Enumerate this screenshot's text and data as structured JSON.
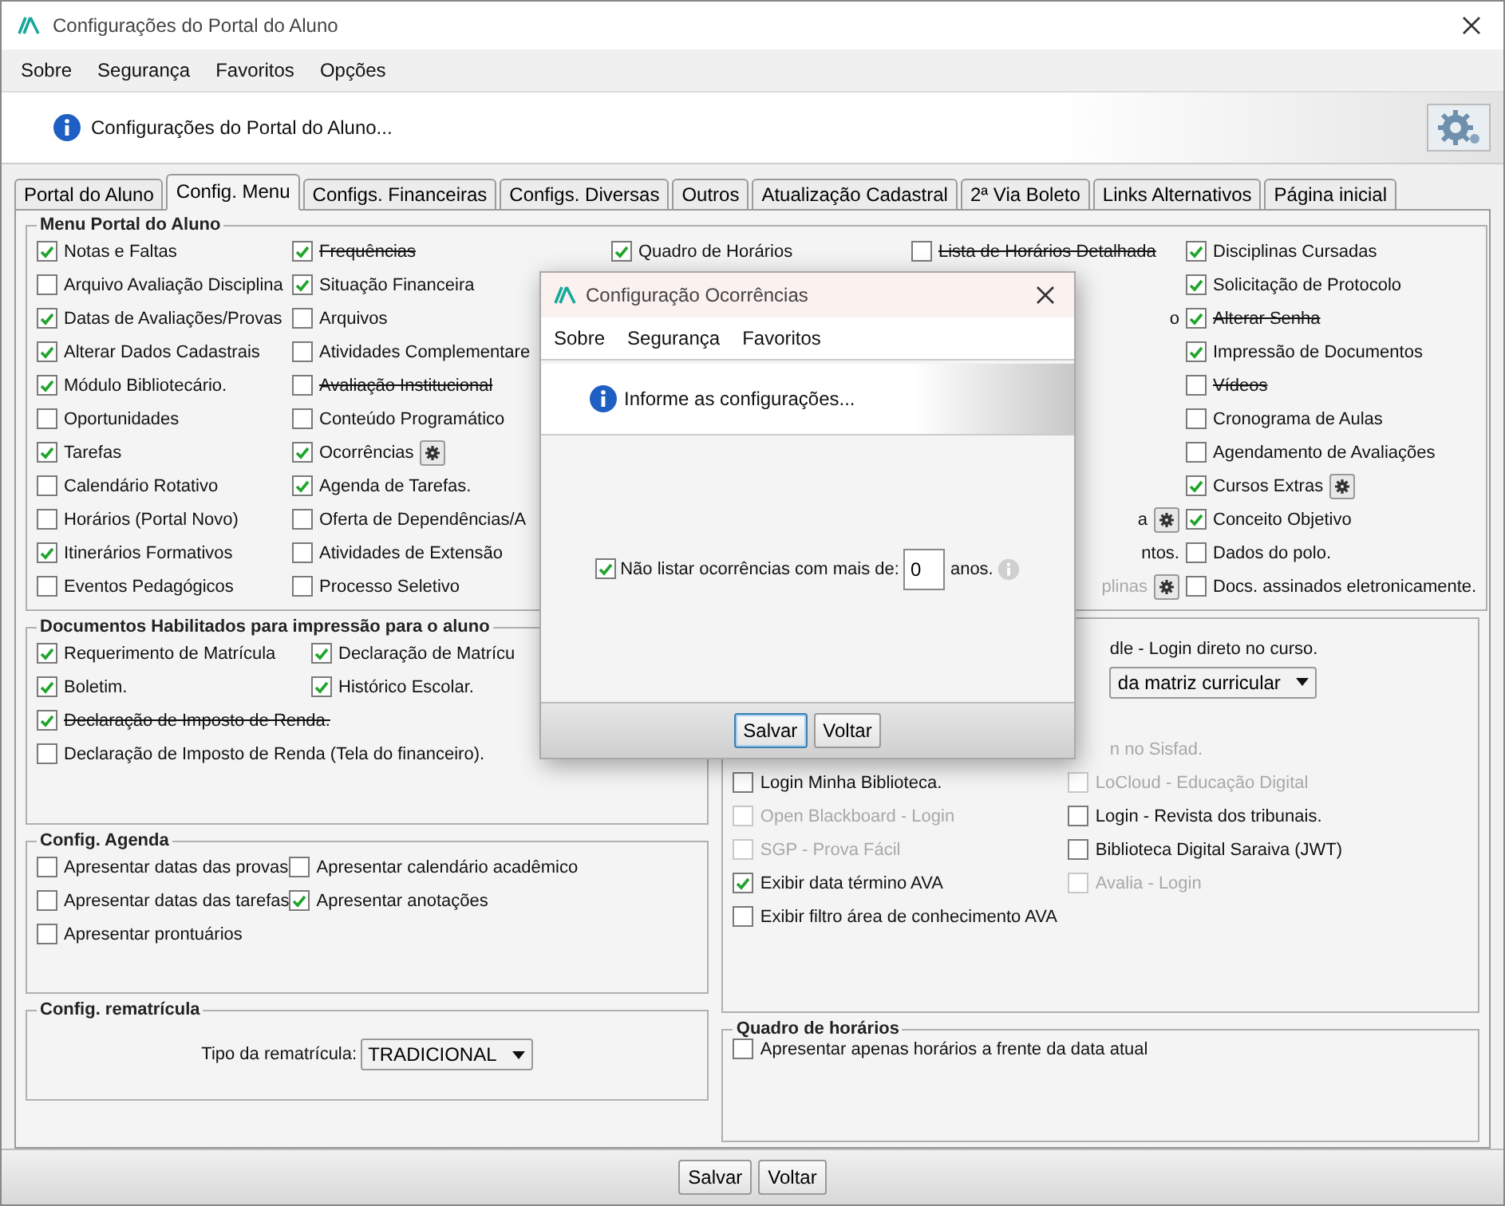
{
  "window": {
    "title": "Configurações do Portal do Aluno"
  },
  "menu_bar": [
    "Sobre",
    "Segurança",
    "Favoritos",
    "Opções"
  ],
  "header": {
    "message": "Configurações do Portal do Aluno..."
  },
  "tabs": [
    {
      "label": "Portal do Aluno",
      "selected": false
    },
    {
      "label": "Config. Menu",
      "selected": true
    },
    {
      "label": "Configs. Financeiras",
      "selected": false
    },
    {
      "label": "Configs. Diversas",
      "selected": false
    },
    {
      "label": "Outros",
      "selected": false
    },
    {
      "label": "Atualização Cadastral",
      "selected": false
    },
    {
      "label": "2ª Via Boleto",
      "selected": false
    },
    {
      "label": "Links Alternativos",
      "selected": false
    },
    {
      "label": "Página inicial",
      "selected": false
    }
  ],
  "menu_group": {
    "title": "Menu Portal do Aluno",
    "columns": [
      [
        {
          "kind": "check",
          "label": "Notas e Faltas",
          "checked": true,
          "struck": false,
          "settings": false
        },
        {
          "kind": "check",
          "label": "Arquivo Avaliação Disciplina",
          "checked": false,
          "struck": false,
          "settings": false
        },
        {
          "kind": "check",
          "label": "Datas de Avaliações/Provas",
          "checked": true,
          "struck": false,
          "settings": false
        },
        {
          "kind": "check",
          "label": "Alterar Dados Cadastrais",
          "checked": true,
          "struck": false,
          "settings": false
        },
        {
          "kind": "check",
          "label": "Módulo Bibliotecário.",
          "checked": true,
          "struck": false,
          "settings": false
        },
        {
          "kind": "check",
          "label": "Oportunidades",
          "checked": false,
          "struck": false,
          "settings": false
        },
        {
          "kind": "check",
          "label": "Tarefas",
          "checked": true,
          "struck": false,
          "settings": false
        },
        {
          "kind": "check",
          "label": "Calendário Rotativo",
          "checked": false,
          "struck": false,
          "settings": false
        },
        {
          "kind": "check",
          "label": "Horários (Portal Novo)",
          "checked": false,
          "struck": false,
          "settings": false
        },
        {
          "kind": "check",
          "label": "Itinerários Formativos",
          "checked": true,
          "struck": false,
          "settings": false
        },
        {
          "kind": "check",
          "label": "Eventos Pedagógicos",
          "checked": false,
          "struck": false,
          "settings": false
        }
      ],
      [
        {
          "kind": "check",
          "label": "Frequências",
          "checked": true,
          "struck": true,
          "settings": false
        },
        {
          "kind": "check",
          "label": "Situação Financeira",
          "checked": true,
          "struck": false,
          "settings": false
        },
        {
          "kind": "check",
          "label": "Arquivos",
          "checked": false,
          "struck": false,
          "settings": false
        },
        {
          "kind": "check",
          "label": "Atividades Complementare",
          "checked": false,
          "struck": false,
          "settings": false
        },
        {
          "kind": "check",
          "label": "Avaliação Institucional",
          "checked": false,
          "struck": true,
          "settings": false
        },
        {
          "kind": "check",
          "label": "Conteúdo Programático",
          "checked": false,
          "struck": false,
          "settings": false
        },
        {
          "kind": "check",
          "label": "Ocorrências",
          "checked": true,
          "struck": false,
          "settings": true
        },
        {
          "kind": "check",
          "label": "Agenda de Tarefas.",
          "checked": true,
          "struck": false,
          "settings": false
        },
        {
          "kind": "check",
          "label": "Oferta de Dependências/A",
          "checked": false,
          "struck": false,
          "settings": false
        },
        {
          "kind": "check",
          "label": "Atividades de Extensão",
          "checked": false,
          "struck": false,
          "settings": false
        },
        {
          "kind": "check",
          "label": "Processo Seletivo",
          "checked": false,
          "struck": false,
          "settings": false
        }
      ],
      [
        {
          "kind": "check",
          "label": "Quadro de Horários",
          "checked": true,
          "struck": false,
          "settings": false
        }
      ],
      [
        {
          "kind": "check",
          "label": "Lista de Horários Detalhada",
          "checked": false,
          "struck": true,
          "settings": false
        },
        {
          "kind": "covered"
        },
        {
          "kind": "clipped",
          "label": "o",
          "disabled": false,
          "settings": false
        },
        {
          "kind": "covered"
        },
        {
          "kind": "covered"
        },
        {
          "kind": "covered"
        },
        {
          "kind": "covered"
        },
        {
          "kind": "covered"
        },
        {
          "kind": "clipped",
          "label": "a",
          "disabled": false,
          "settings": true
        },
        {
          "kind": "clipped",
          "label": "ntos.",
          "disabled": false,
          "settings": false
        },
        {
          "kind": "clipped",
          "label": "plinas",
          "disabled": true,
          "settings": true
        }
      ],
      [
        {
          "kind": "check",
          "label": "Disciplinas Cursadas",
          "checked": true,
          "struck": false,
          "settings": false
        },
        {
          "kind": "check",
          "label": "Solicitação de Protocolo",
          "checked": true,
          "struck": false,
          "settings": false
        },
        {
          "kind": "check",
          "label": "Alterar Senha",
          "checked": true,
          "struck": true,
          "settings": false
        },
        {
          "kind": "check",
          "label": "Impressão de Documentos",
          "checked": true,
          "struck": false,
          "settings": false
        },
        {
          "kind": "check",
          "label": "Vídeos",
          "checked": false,
          "struck": true,
          "settings": false
        },
        {
          "kind": "check",
          "label": "Cronograma de Aulas",
          "checked": false,
          "struck": false,
          "settings": false
        },
        {
          "kind": "check",
          "label": "Agendamento de Avaliações",
          "checked": false,
          "struck": false,
          "settings": false
        },
        {
          "kind": "check",
          "label": "Cursos Extras",
          "checked": true,
          "struck": false,
          "settings": true
        },
        {
          "kind": "check",
          "label": "Conceito Objetivo",
          "checked": true,
          "struck": false,
          "settings": false
        },
        {
          "kind": "check",
          "label": "Dados do polo.",
          "checked": false,
          "struck": false,
          "settings": false
        },
        {
          "kind": "check",
          "label": "Docs. assinados eletronicamente.",
          "checked": false,
          "struck": false,
          "settings": false
        }
      ]
    ]
  },
  "documents_group": {
    "title": "Documentos Habilitados para impressão para o aluno",
    "rows": [
      [
        {
          "label": "Requerimento de Matrícula",
          "checked": true,
          "struck": false
        },
        {
          "label": "Declaração de Matrícu",
          "checked": true,
          "struck": false
        }
      ],
      [
        {
          "label": "Boletim.",
          "checked": true,
          "struck": false
        },
        {
          "label": "Histórico Escolar.",
          "checked": true,
          "struck": false
        }
      ],
      [
        {
          "label": "Declaração de Imposto de Renda.",
          "checked": true,
          "struck": true
        }
      ],
      [
        {
          "label": "Declaração de Imposto de Renda (Tela do financeiro).",
          "checked": false,
          "struck": false
        }
      ]
    ]
  },
  "agenda_group": {
    "title": "Config. Agenda",
    "rows": [
      [
        {
          "label": "Apresentar datas das provas",
          "checked": false
        },
        {
          "label": "Apresentar calendário acadêmico",
          "checked": false
        }
      ],
      [
        {
          "label": "Apresentar datas das tarefas",
          "checked": false
        },
        {
          "label": "Apresentar anotações",
          "checked": true
        }
      ],
      [
        {
          "label": "Apresentar prontuários",
          "checked": false
        }
      ]
    ]
  },
  "rematricula_group": {
    "title": "Config. rematrícula",
    "label": "Tipo da rematrícula:",
    "value": "TRADICIONAL"
  },
  "links_group": {
    "top": [
      {
        "kind": "text",
        "label": "dle - Login direto no curso.",
        "disabled": false
      },
      {
        "kind": "select",
        "label": "da matriz curricular"
      },
      {
        "kind": "text",
        "label": "n no Sisfad.",
        "disabled": true
      }
    ],
    "rows": [
      [
        {
          "label": "Login Minha Biblioteca.",
          "checked": false,
          "disabled": false
        },
        {
          "label": "LoCloud - Educação Digital",
          "checked": false,
          "disabled": true
        }
      ],
      [
        {
          "label": "Open Blackboard - Login",
          "checked": false,
          "disabled": true
        },
        {
          "label": "Login - Revista dos tribunais.",
          "checked": false,
          "disabled": false
        }
      ],
      [
        {
          "label": "SGP - Prova Fácil",
          "checked": false,
          "disabled": true
        },
        {
          "label": "Biblioteca Digital Saraiva (JWT)",
          "checked": false,
          "disabled": false
        }
      ],
      [
        {
          "label": "Exibir data término AVA",
          "checked": true,
          "disabled": false
        },
        {
          "label": "Avalia - Login",
          "checked": false,
          "disabled": true
        }
      ],
      [
        {
          "label": "Exibir filtro área de conhecimento AVA",
          "checked": false,
          "disabled": false
        }
      ]
    ]
  },
  "schedule_group": {
    "title": "Quadro de horários",
    "items": [
      {
        "label": "Apresentar apenas horários a frente da data atual",
        "checked": false
      }
    ]
  },
  "buttons": [
    "Salvar",
    "Voltar"
  ],
  "dialog": {
    "title": "Configuração Ocorrências",
    "menu_bar": [
      "Sobre",
      "Segurança",
      "Favoritos"
    ],
    "message": "Informe as configurações...",
    "option": {
      "label": "Não listar ocorrências com mais de:",
      "checked": true,
      "value": "0",
      "unit": "anos."
    },
    "buttons": [
      {
        "label": "Salvar",
        "focused": true
      },
      {
        "label": "Voltar",
        "focused": false
      }
    ]
  }
}
